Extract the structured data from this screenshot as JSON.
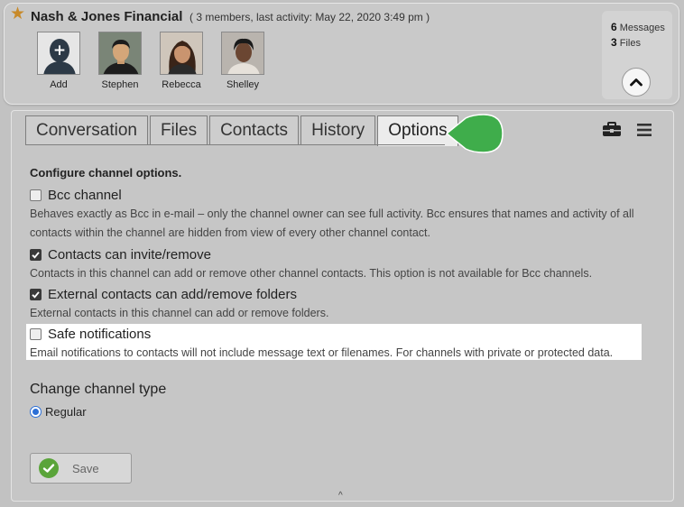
{
  "channel": {
    "title": "Nash & Jones Financial",
    "meta": "( 3 members, last activity: May 22, 2020 3:49 pm )",
    "favorite_icon": "star-icon",
    "members": [
      {
        "name": "Add",
        "icon": "add-user-icon"
      },
      {
        "name": "Stephen"
      },
      {
        "name": "Rebecca"
      },
      {
        "name": "Shelley"
      }
    ]
  },
  "stats": {
    "messages_count": "6",
    "messages_label": "Messages",
    "files_count": "3",
    "files_label": "Files",
    "collapse_icon": "chevron-up-icon"
  },
  "tabs": [
    {
      "label": "Conversation",
      "active": false
    },
    {
      "label": "Files",
      "active": false
    },
    {
      "label": "Contacts",
      "active": false
    },
    {
      "label": "History",
      "active": false
    },
    {
      "label": "Options",
      "active": true
    }
  ],
  "toolbar": {
    "briefcase_icon": "briefcase-icon",
    "menu_icon": "hamburger-menu-icon"
  },
  "options": {
    "section_title": "Configure channel options.",
    "items": [
      {
        "label": "Bcc channel",
        "checked": false,
        "description": "Behaves exactly as Bcc in e-mail – only the channel owner can see full activity. Bcc ensures that names and activity of all contacts within the channel are hidden from view of every other channel contact."
      },
      {
        "label": "Contacts can invite/remove",
        "checked": true,
        "description": "Contacts in this channel can add or remove other channel contacts. This option is not available for Bcc channels."
      },
      {
        "label": "External contacts can add/remove folders",
        "checked": true,
        "description": "External contacts in this channel can add or remove folders."
      },
      {
        "label": "Safe notifications",
        "checked": false,
        "highlighted": true,
        "description": "Email notifications to contacts will not include message text or filenames. For channels with private or protected data."
      }
    ]
  },
  "channel_type": {
    "heading": "Change channel type",
    "selected": "Regular"
  },
  "save": {
    "label": "Save"
  },
  "colors": {
    "accent_green": "#3fad4b",
    "save_green": "#5aa43a",
    "radio_blue": "#2c6fd6"
  }
}
